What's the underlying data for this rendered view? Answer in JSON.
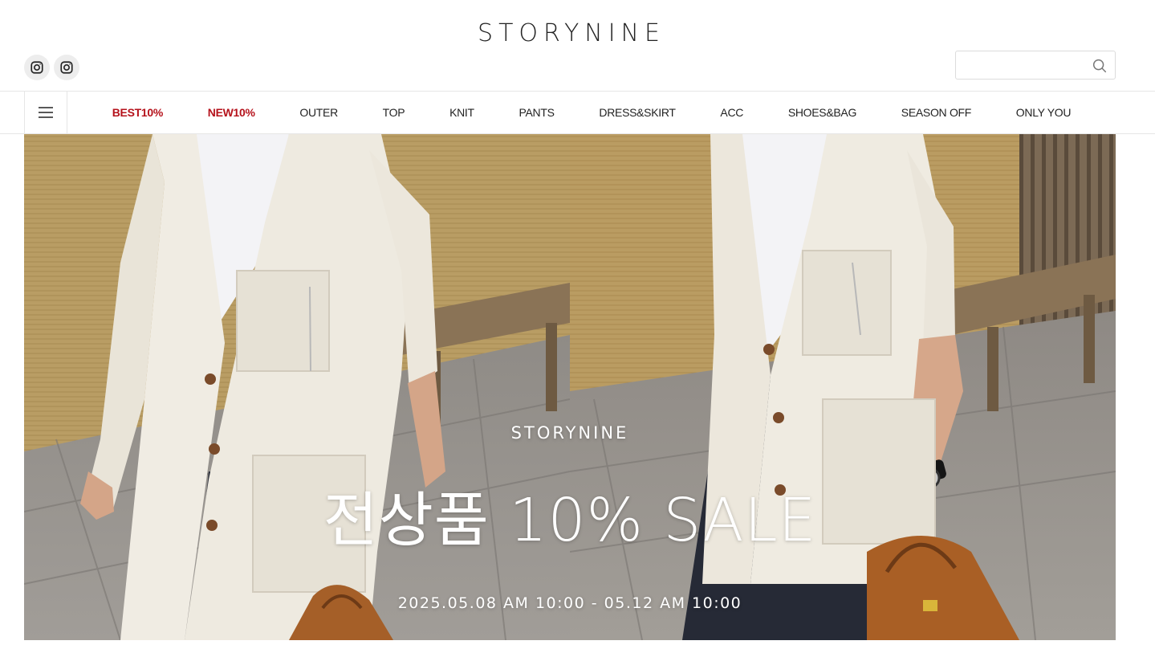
{
  "header": {
    "logo": "STORYNINE",
    "social": [
      {
        "icon": "instagram-icon"
      },
      {
        "icon": "instagram-icon"
      }
    ],
    "search": {
      "value": "",
      "placeholder": "",
      "icon": "search-icon"
    }
  },
  "nav": {
    "menu_icon": "hamburger-menu-icon",
    "items": [
      {
        "label": "BEST10%",
        "accent": true
      },
      {
        "label": "NEW10%",
        "accent": true
      },
      {
        "label": "OUTER",
        "accent": false
      },
      {
        "label": "TOP",
        "accent": false
      },
      {
        "label": "KNIT",
        "accent": false
      },
      {
        "label": "PANTS",
        "accent": false
      },
      {
        "label": "DRESS&SKIRT",
        "accent": false
      },
      {
        "label": "ACC",
        "accent": false
      },
      {
        "label": "SHOES&BAG",
        "accent": false
      },
      {
        "label": "SEASON OFF",
        "accent": false
      },
      {
        "label": "ONLY YOU",
        "accent": false
      }
    ]
  },
  "banner": {
    "brand": "STORYNINE",
    "title": "전상품 10% SALE",
    "date": "2025.05.08 AM 10:00 - 05.12 AM 10:00"
  },
  "colors": {
    "accent": "#b5121b",
    "text": "#222222",
    "border": "#e6e6e6"
  }
}
